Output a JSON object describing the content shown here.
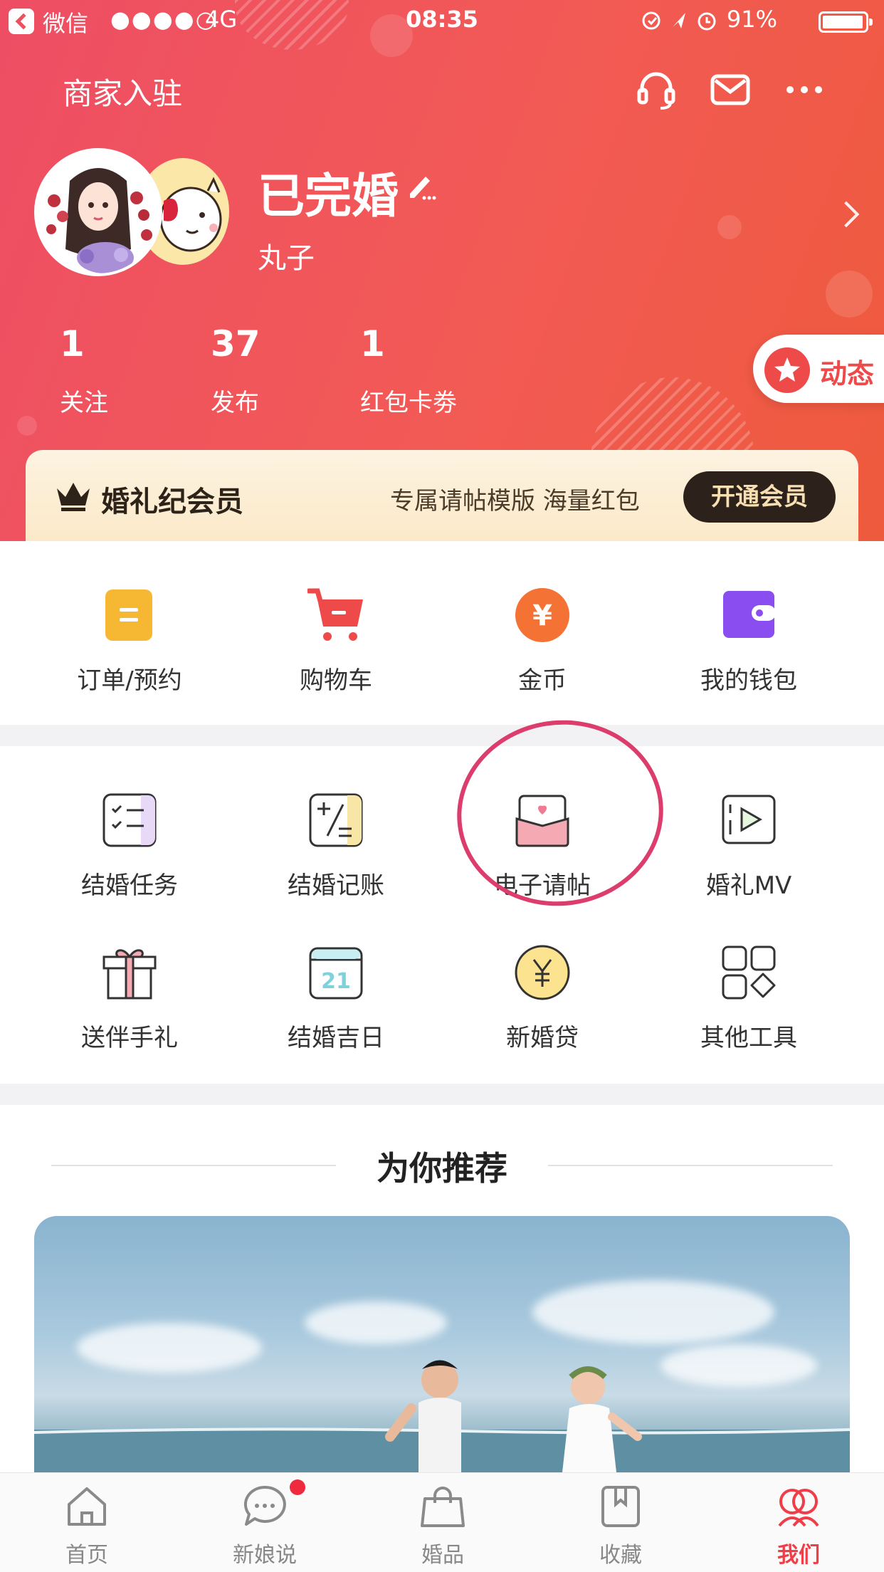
{
  "status_bar": {
    "app": "微信",
    "signal": "●●●●○",
    "network": "4G",
    "time": "08:35",
    "battery": "91%"
  },
  "header": {
    "merchant_link": "商家入驻",
    "icons": [
      "headset-icon",
      "mail-icon",
      "more-icon"
    ]
  },
  "profile": {
    "status": "已完婚",
    "nickname": "丸子"
  },
  "stats": [
    {
      "value": "1",
      "label": "关注"
    },
    {
      "value": "37",
      "label": "发布"
    },
    {
      "value": "1",
      "label": "红包卡劵"
    }
  ],
  "dongtai": {
    "label": "动态"
  },
  "membership": {
    "title": "婚礼纪会员",
    "desc": "专属请帖模版 海量红包",
    "button": "开通会员"
  },
  "quick_actions": [
    {
      "label": "订单/预约",
      "icon": "order-icon",
      "color": "#f6b733"
    },
    {
      "label": "购物车",
      "icon": "cart-icon",
      "color": "#ef4a4a"
    },
    {
      "label": "金币",
      "icon": "coin-icon",
      "color": "#f37234"
    },
    {
      "label": "我的钱包",
      "icon": "wallet-icon",
      "color": "#8a4ef0"
    }
  ],
  "tools": [
    {
      "label": "结婚任务",
      "icon": "task-checklist-icon"
    },
    {
      "label": "结婚记账",
      "icon": "accounting-icon"
    },
    {
      "label": "电子请帖",
      "icon": "invitation-envelope-icon"
    },
    {
      "label": "婚礼MV",
      "icon": "video-play-icon"
    },
    {
      "label": "送伴手礼",
      "icon": "gift-icon"
    },
    {
      "label": "结婚吉日",
      "icon": "calendar-icon"
    },
    {
      "label": "新婚贷",
      "icon": "loan-yen-icon"
    },
    {
      "label": "其他工具",
      "icon": "grid-apps-icon"
    }
  ],
  "calendar_day": "21",
  "recommend": {
    "title": "为你推荐"
  },
  "tabbar": [
    {
      "label": "首页",
      "icon": "home-icon"
    },
    {
      "label": "新娘说",
      "icon": "chat-bubble-icon"
    },
    {
      "label": "婚品",
      "icon": "shopping-bag-icon"
    },
    {
      "label": "收藏",
      "icon": "bookmark-icon"
    },
    {
      "label": "我们",
      "icon": "couple-icon"
    }
  ],
  "colors": {
    "brand_red": "#ef4a4a",
    "annotation_circle": "#dc3d6c"
  }
}
